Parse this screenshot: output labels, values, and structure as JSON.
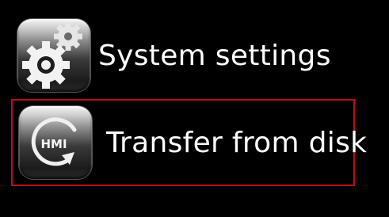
{
  "menu": {
    "items": [
      {
        "label": "System settings",
        "icon": "gears-icon",
        "selected": false
      },
      {
        "label": "Transfer from disk",
        "icon": "hmi-transfer-icon",
        "icon_text": "HMI",
        "selected": true
      }
    ]
  },
  "colors": {
    "background": "#000000",
    "text": "#ffffff",
    "selection_border": "#b5121b"
  }
}
